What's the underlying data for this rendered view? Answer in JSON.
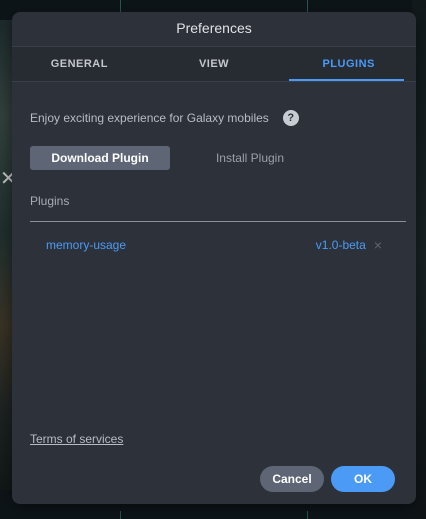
{
  "dialog": {
    "title": "Preferences"
  },
  "tabs": [
    {
      "label": "GENERAL",
      "active": false
    },
    {
      "label": "VIEW",
      "active": false
    },
    {
      "label": "PLUGINS",
      "active": true
    }
  ],
  "plugins_tab": {
    "intro_text": "Enjoy exciting experience for Galaxy mobiles",
    "help_icon": "help-icon",
    "subtabs": [
      {
        "label": "Download Plugin",
        "active": true
      },
      {
        "label": "Install Plugin",
        "active": false
      }
    ],
    "section_label": "Plugins",
    "items": [
      {
        "name": "memory-usage",
        "version": "v1.0-beta",
        "remove_glyph": "×"
      }
    ],
    "terms_link": "Terms of services"
  },
  "footer": {
    "cancel_label": "Cancel",
    "ok_label": "OK"
  },
  "background": {
    "mark_glyph": "✕"
  },
  "colors": {
    "accent": "#4b9af6",
    "dialog_bg": "#2d323a",
    "secondary_button": "#5e6675"
  }
}
